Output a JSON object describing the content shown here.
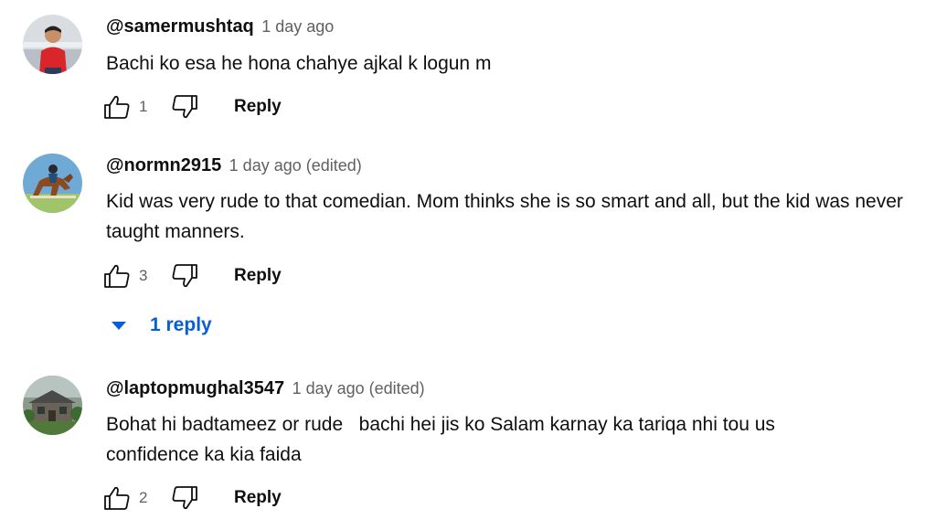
{
  "comments": [
    {
      "author": "@samermushtaq",
      "time": "1 day ago",
      "text": "Bachi ko esa he hona chahye ajkal k logun m",
      "likes": "1",
      "reply_label": "Reply"
    },
    {
      "author": "@normn2915",
      "time": "1 day ago (edited)",
      "text": "Kid was very rude to that comedian. Mom thinks she is so smart and all, but the kid was never taught manners.",
      "likes": "3",
      "reply_label": "Reply",
      "replies_toggle": "1 reply"
    },
    {
      "author": "@laptopmughal3547",
      "time": "1 day ago (edited)",
      "text": "Bohat hi badtameez or rude   bachi hei jis ko Salam karnay ka tariqa nhi tou us confidence ka kia faida",
      "likes": "2",
      "reply_label": "Reply"
    }
  ],
  "colors": {
    "link_blue": "#065fd4",
    "secondary_text": "#606060"
  },
  "icons": [
    "thumbs-up-icon",
    "thumbs-down-icon",
    "caret-down-icon",
    "avatar-image"
  ]
}
